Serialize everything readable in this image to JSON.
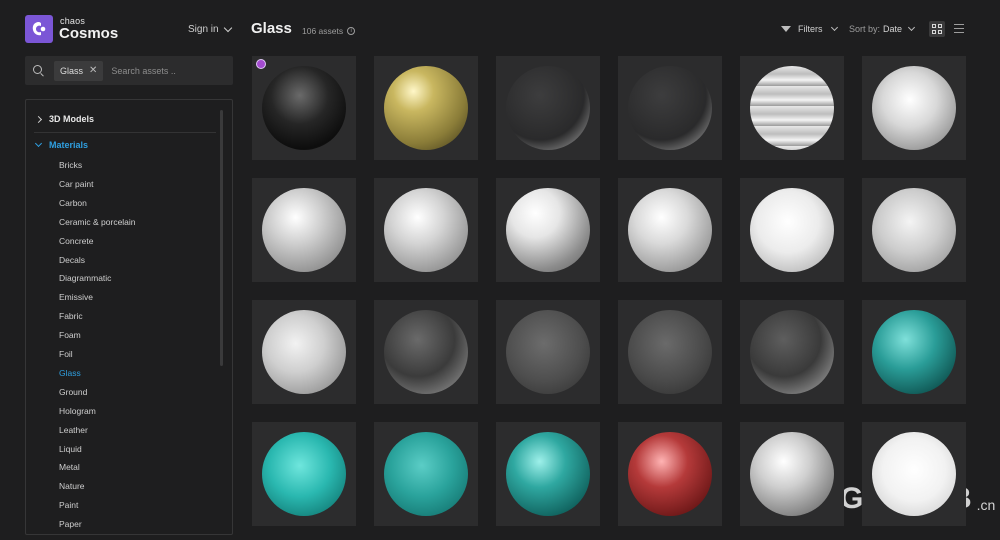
{
  "brand": {
    "small": "chaos",
    "name": "Cosmos",
    "logo_color": "#7b56d6"
  },
  "header": {
    "signin_label": "Sign in"
  },
  "search": {
    "chip_label": "Glass",
    "placeholder": "Search assets .."
  },
  "tree": {
    "categories": [
      {
        "label": "3D Models",
        "expanded": false
      },
      {
        "label": "Materials",
        "expanded": true
      }
    ],
    "materials": [
      "Bricks",
      "Car paint",
      "Carbon",
      "Ceramic & porcelain",
      "Concrete",
      "Decals",
      "Diagrammatic",
      "Emissive",
      "Fabric",
      "Foam",
      "Foil",
      "Glass",
      "Ground",
      "Hologram",
      "Leather",
      "Liquid",
      "Metal",
      "Nature",
      "Paint",
      "Paper"
    ],
    "active": "Glass",
    "accent": "#2f9fe0"
  },
  "main": {
    "title": "Glass",
    "count": "106 assets",
    "filters_label": "Filters",
    "sort_prefix": "Sort by:",
    "sort_value": "Date"
  },
  "watermark": {
    "text": "GFXHUB",
    "suffix": ".cn"
  }
}
